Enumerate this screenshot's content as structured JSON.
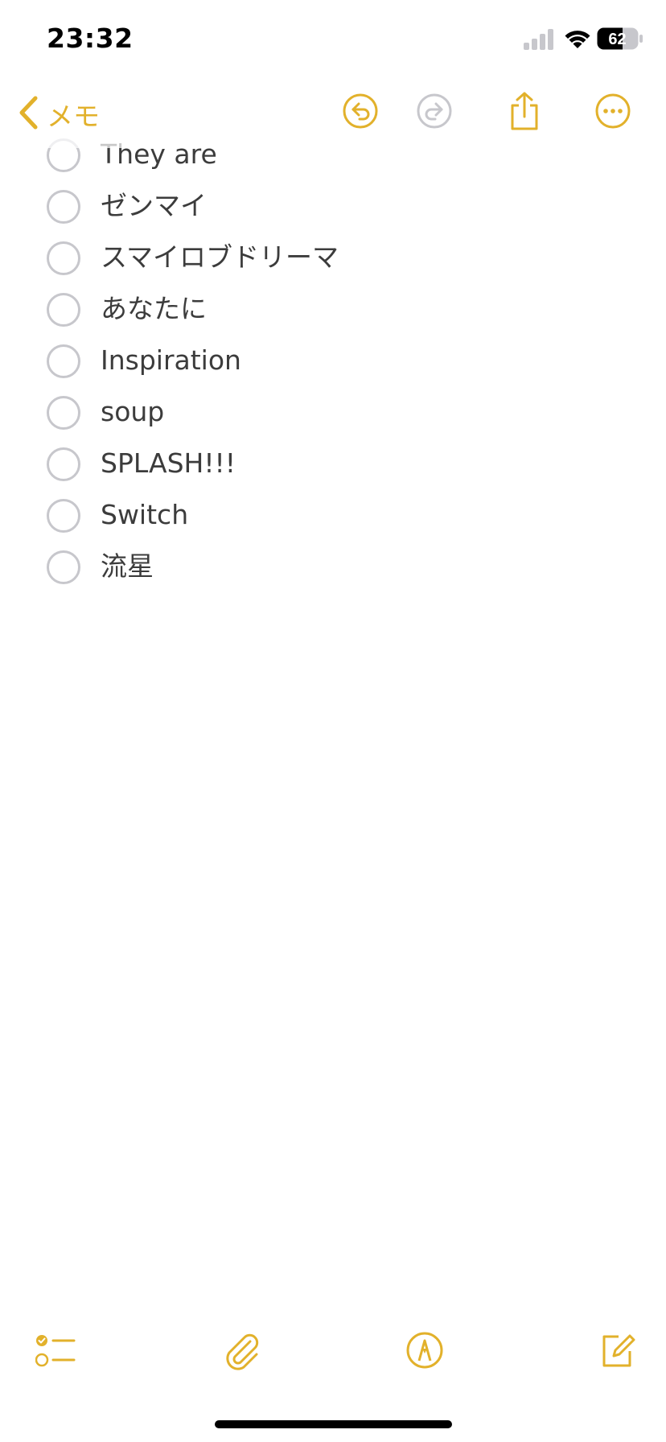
{
  "status_bar": {
    "time": "23:32",
    "battery_level": "62",
    "signal_icon": "cellular-signal-icon",
    "wifi_icon": "wifi-icon",
    "battery_icon": "battery-icon"
  },
  "nav": {
    "back_label": "メモ",
    "back_icon": "chevron-left-icon",
    "buttons": [
      {
        "icon": "undo-icon",
        "enabled": true
      },
      {
        "icon": "redo-icon",
        "enabled": false
      },
      {
        "icon": "share-icon",
        "enabled": true
      },
      {
        "icon": "more-icon",
        "enabled": true
      }
    ]
  },
  "checklist": {
    "items": [
      {
        "label": "They are",
        "checked": false
      },
      {
        "label": "ゼンマイ",
        "checked": false
      },
      {
        "label": "スマイロブドリーマ",
        "checked": false
      },
      {
        "label": "あなたに",
        "checked": false
      },
      {
        "label": "Inspiration",
        "checked": false
      },
      {
        "label": "soup",
        "checked": false
      },
      {
        "label": "SPLASH!!!",
        "checked": false
      },
      {
        "label": "Switch",
        "checked": false
      },
      {
        "label": "流星",
        "checked": false
      }
    ]
  },
  "toolbar": {
    "buttons": [
      {
        "icon": "checklist-icon"
      },
      {
        "icon": "paperclip-icon"
      },
      {
        "icon": "markup-pen-icon"
      },
      {
        "icon": "compose-icon"
      }
    ]
  },
  "colors": {
    "accent": "#E2B12B",
    "text": "#3c3c3c",
    "checkbox_border": "#c7c7cc",
    "disabled": "#c7c7cc"
  }
}
